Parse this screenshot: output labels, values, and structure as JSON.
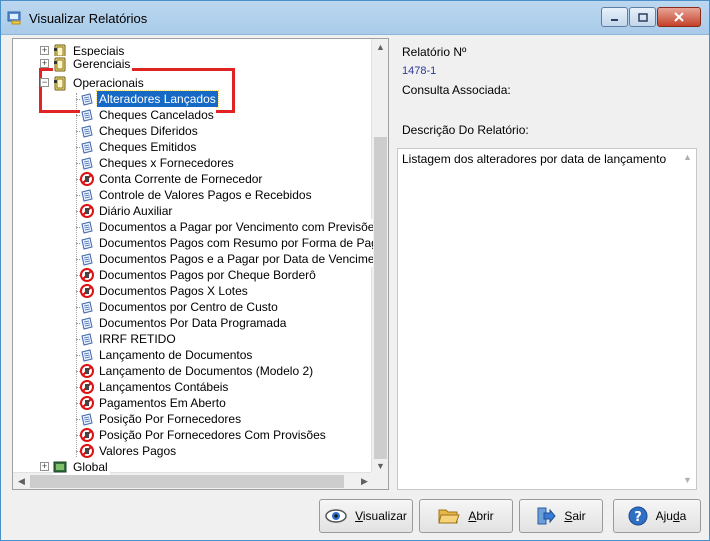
{
  "window": {
    "title": "Visualizar Relatórios"
  },
  "tree": {
    "nodes": [
      {
        "label": "Especiais",
        "kind": "folder",
        "expander": "+",
        "level": 0
      },
      {
        "label": "Gerenciais",
        "kind": "folder",
        "expander": "+",
        "level": 0
      },
      {
        "label": "Operacionais",
        "kind": "folder",
        "expander": "−",
        "level": 0
      },
      {
        "label": "Alteradores Lançados",
        "kind": "report",
        "level": 1,
        "selected": true
      },
      {
        "label": "Cheques Cancelados",
        "kind": "report",
        "level": 1
      },
      {
        "label": "Cheques Diferidos",
        "kind": "report",
        "level": 1
      },
      {
        "label": "Cheques Emitidos",
        "kind": "report",
        "level": 1
      },
      {
        "label": "Cheques x Fornecedores",
        "kind": "report",
        "level": 1
      },
      {
        "label": "Conta Corrente de Fornecedor",
        "kind": "blocked",
        "level": 1
      },
      {
        "label": "Controle de Valores Pagos e Recebidos",
        "kind": "report",
        "level": 1
      },
      {
        "label": "Diário Auxiliar",
        "kind": "blocked",
        "level": 1
      },
      {
        "label": "Documentos a Pagar por Vencimento com Previsões",
        "kind": "report",
        "level": 1
      },
      {
        "label": "Documentos Pagos com Resumo por Forma de Pagam",
        "kind": "report",
        "level": 1
      },
      {
        "label": "Documentos Pagos e a Pagar por Data de Vencimento",
        "kind": "report",
        "level": 1
      },
      {
        "label": "Documentos Pagos por Cheque Borderô",
        "kind": "blocked",
        "level": 1
      },
      {
        "label": "Documentos Pagos X Lotes",
        "kind": "blocked",
        "level": 1
      },
      {
        "label": "Documentos por Centro de Custo",
        "kind": "report",
        "level": 1
      },
      {
        "label": "Documentos Por Data Programada",
        "kind": "report",
        "level": 1
      },
      {
        "label": "IRRF RETIDO",
        "kind": "report",
        "level": 1
      },
      {
        "label": "Lançamento de Documentos",
        "kind": "report",
        "level": 1
      },
      {
        "label": "Lançamento de Documentos (Modelo 2)",
        "kind": "blocked",
        "level": 1
      },
      {
        "label": "Lançamentos Contábeis",
        "kind": "blocked",
        "level": 1
      },
      {
        "label": "Pagamentos Em Aberto",
        "kind": "blocked",
        "level": 1
      },
      {
        "label": "Posição Por Fornecedores",
        "kind": "report",
        "level": 1
      },
      {
        "label": "Posição Por Fornecedores Com Provisões",
        "kind": "blocked",
        "level": 1
      },
      {
        "label": "Valores Pagos",
        "kind": "blocked",
        "level": 1
      },
      {
        "label": "Global",
        "kind": "globe",
        "expander": "+",
        "level": 0
      }
    ]
  },
  "details": {
    "report_number_label": "Relatório Nº",
    "report_number_value": "1478-1",
    "query_label": "Consulta Associada:",
    "description_label": "Descrição Do Relatório:",
    "description_text": "Listagem dos alteradores por data de lançamento"
  },
  "buttons": {
    "visualizar": {
      "hot": "V",
      "rest": "isualizar"
    },
    "abrir": {
      "hot": "A",
      "rest": "brir"
    },
    "sair": {
      "hot": "S",
      "rest": "air"
    },
    "ajuda": {
      "pre": "Aju",
      "hot": "d",
      "rest": "a"
    }
  },
  "colors": {
    "selection": "#1769c6",
    "highlight": "#e02424",
    "report_value": "#2a3a9a"
  }
}
